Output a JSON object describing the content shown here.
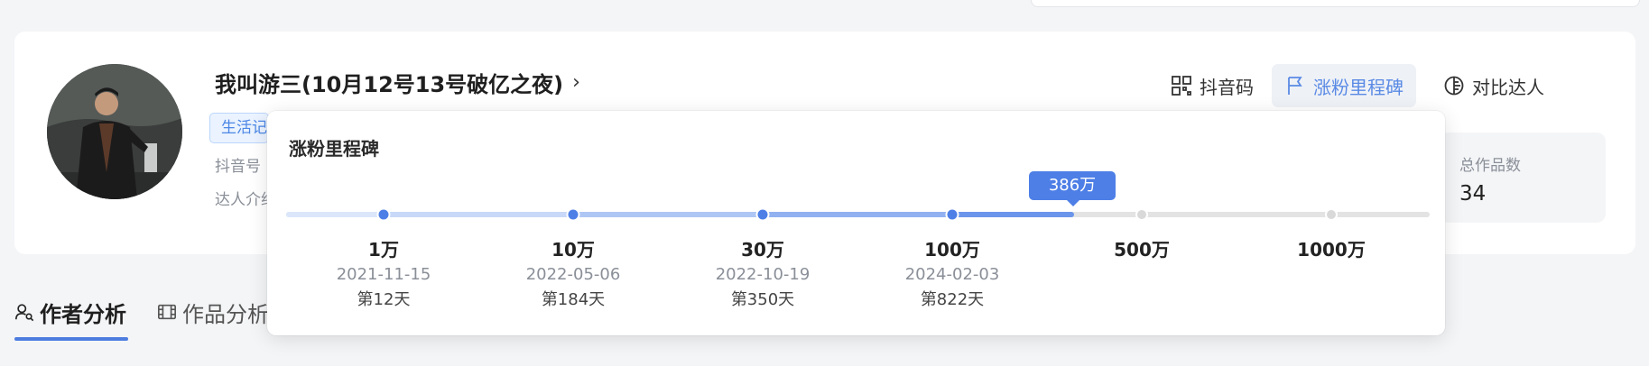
{
  "profile": {
    "name": "我叫游三(10月12号13号破亿之夜)",
    "chevron": "›",
    "tag": "生活记录",
    "douyin_id_label": "抖音号",
    "intro_label": "达人介绍"
  },
  "actions": [
    {
      "label": "抖音码",
      "icon": "qrcode-icon"
    },
    {
      "label": "涨粉里程碑",
      "icon": "flag-icon"
    },
    {
      "label": "对比达人",
      "icon": "compare-icon"
    }
  ],
  "stats": {
    "total_works_label": "总作品数",
    "total_works_value": "34"
  },
  "tabs": [
    {
      "label": "作者分析",
      "icon": "user-search-icon"
    },
    {
      "label": "作品分析",
      "icon": "film-icon"
    }
  ],
  "milestone_popover": {
    "title": "涨粉里程碑",
    "current": "386万",
    "current_value_wan": 386,
    "milestones": [
      {
        "label": "1万",
        "date": "2021-11-15",
        "day": "第12天",
        "reached": true
      },
      {
        "label": "10万",
        "date": "2022-05-06",
        "day": "第184天",
        "reached": true
      },
      {
        "label": "30万",
        "date": "2022-10-19",
        "day": "第350天",
        "reached": true
      },
      {
        "label": "100万",
        "date": "2024-02-03",
        "day": "第822天",
        "reached": true
      },
      {
        "label": "500万",
        "date": "",
        "day": "",
        "reached": false
      },
      {
        "label": "1000万",
        "date": "",
        "day": "",
        "reached": false
      }
    ]
  },
  "colors": {
    "accent": "#4e7fe6",
    "tag_bg": "#eaf3ff",
    "track_inactive": "#e3e3e3"
  }
}
